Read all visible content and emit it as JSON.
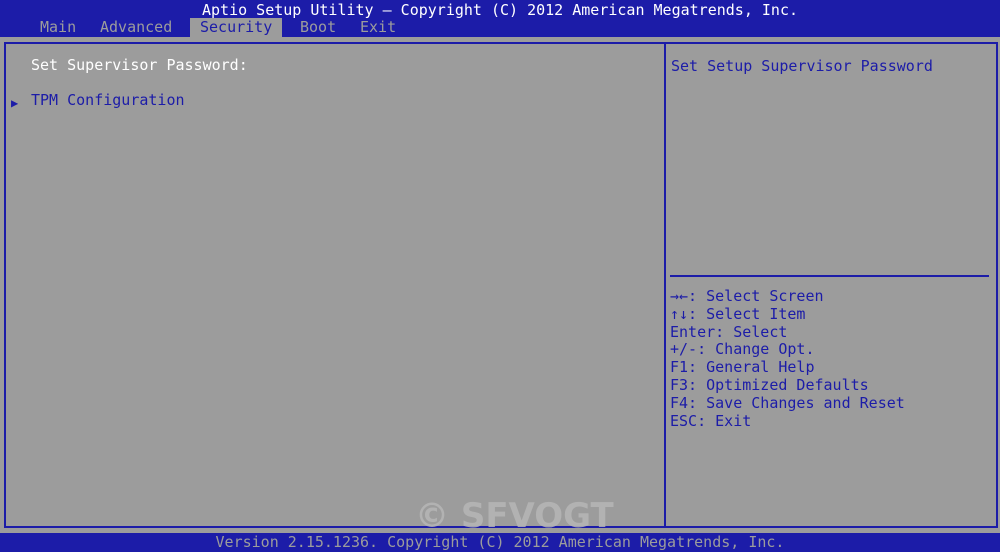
{
  "window": {
    "title": "Aptio Setup Utility – Copyright (C) 2012 American Megatrends, Inc."
  },
  "tabs": [
    {
      "label": "Main",
      "active": false
    },
    {
      "label": "Advanced",
      "active": false
    },
    {
      "label": "Security",
      "active": true
    },
    {
      "label": "Boot",
      "active": false
    },
    {
      "label": "Exit",
      "active": false
    }
  ],
  "main": {
    "items": [
      {
        "label": "Set Supervisor Password:",
        "type": "static"
      },
      {
        "label": "TPM Configuration",
        "type": "submenu",
        "icon": "right-triangle-icon"
      }
    ]
  },
  "help": {
    "description": "Set Setup Supervisor Password",
    "keys": [
      "→←: Select Screen",
      "↑↓: Select Item",
      "Enter: Select",
      "+/-: Change Opt.",
      "F1: General Help",
      "F3: Optimized Defaults",
      "F4: Save Changes and Reset",
      "ESC: Exit"
    ]
  },
  "footer": {
    "text": "Version 2.15.1236. Copyright (C) 2012 American Megatrends, Inc."
  },
  "watermark": {
    "text": "© SFVOGT"
  },
  "colors": {
    "bar": "#1c1ca8",
    "panel": "#9c9c9c",
    "title_text": "#ffffff",
    "item_text": "#1c1ca8"
  }
}
